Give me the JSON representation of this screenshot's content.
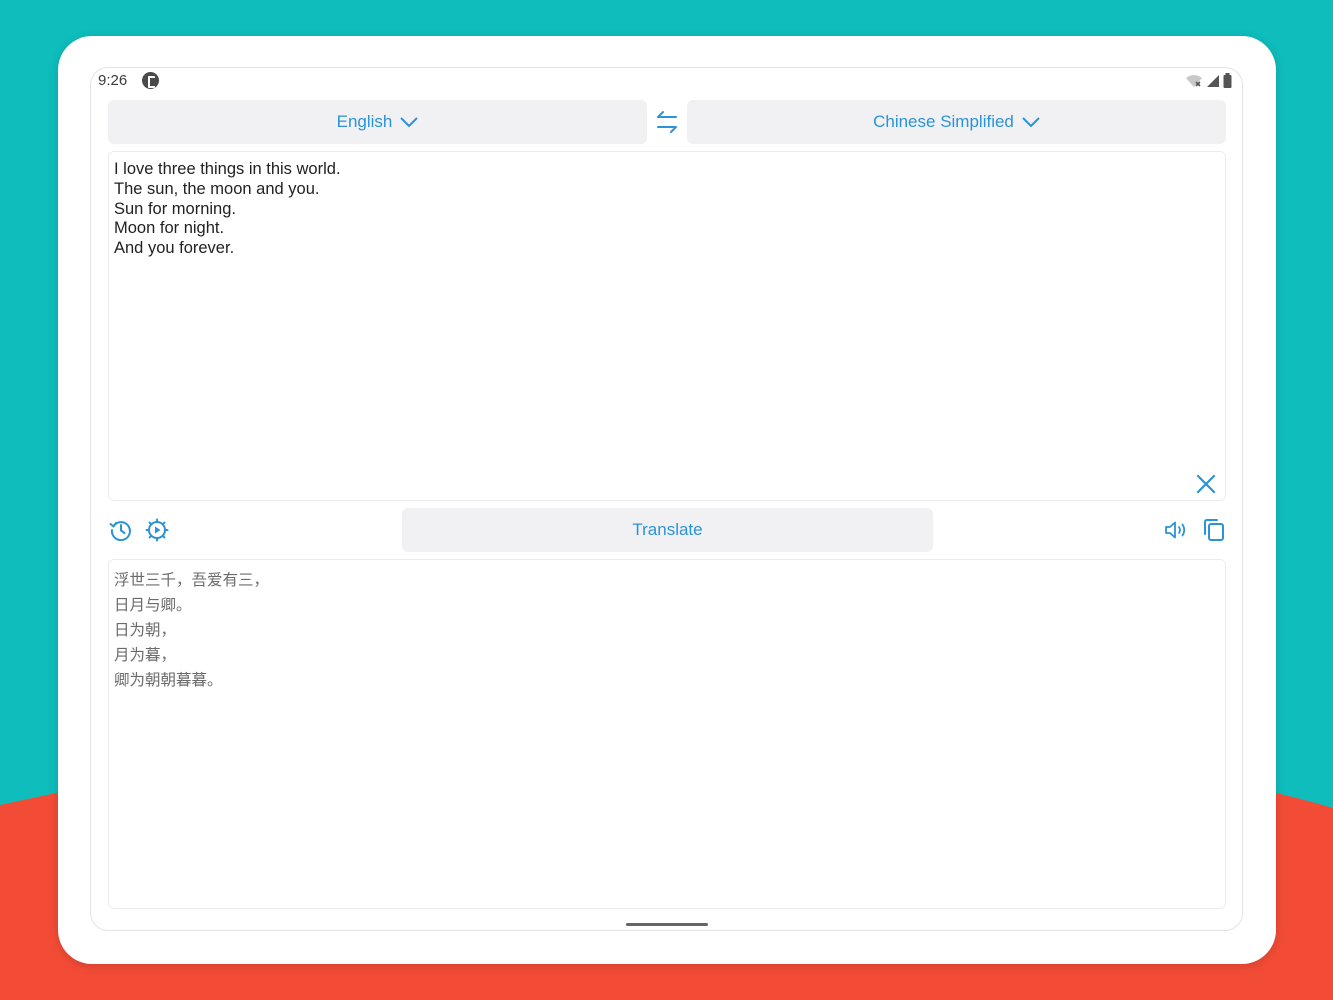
{
  "status_bar": {
    "time": "9:26"
  },
  "languages": {
    "source": "English",
    "target": "Chinese Simplified"
  },
  "input": {
    "text": "I love three things in this world.\nThe sun, the moon and you.\nSun for morning.\nMoon for night.\nAnd you forever."
  },
  "actions": {
    "translate_label": "Translate"
  },
  "output": {
    "text": "浮世三千，吾爱有三，\n日月与卿。\n日为朝，\n月为暮，\n卿为朝朝暮暮。"
  },
  "icons": {
    "swap": "swap-arrows-icon",
    "clear": "close-icon",
    "history": "history-icon",
    "settings": "settings-icon",
    "speaker": "speaker-icon",
    "copy": "copy-icon"
  },
  "colors": {
    "accent": "#2b93d6",
    "background_teal": "#0fbdbc",
    "background_red": "#f34c36",
    "button_bg": "#f1f1f4"
  }
}
